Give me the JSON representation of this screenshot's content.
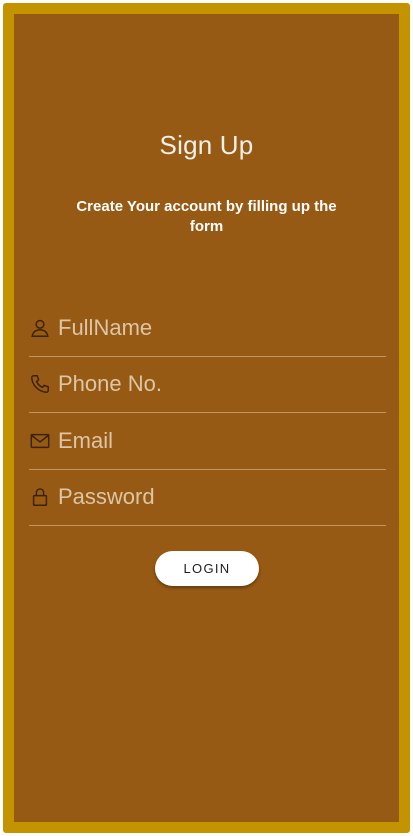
{
  "form": {
    "title": "Sign Up",
    "subtitle": "Create Your account by filling up the form",
    "fields": [
      {
        "icon": "user-icon",
        "placeholder": "FullName",
        "value": ""
      },
      {
        "icon": "phone-icon",
        "placeholder": "Phone No.",
        "value": ""
      },
      {
        "icon": "mail-icon",
        "placeholder": "Email",
        "value": ""
      },
      {
        "icon": "lock-icon",
        "placeholder": "Password",
        "value": ""
      }
    ],
    "submit_label": "LOGIN"
  },
  "colors": {
    "background": "#975a14",
    "border": "#c49300",
    "text": "#ffffff",
    "placeholder": "#dcc6a6"
  }
}
